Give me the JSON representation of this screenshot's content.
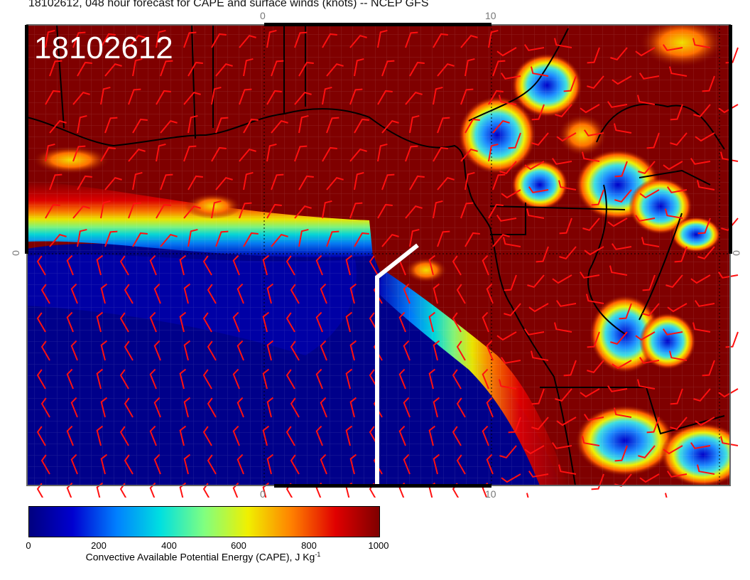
{
  "header": {
    "title": "18102612, 048 hour forecast for CAPE and surface winds (knots) -- NCEP GFS",
    "stamp": "18102612"
  },
  "axes": {
    "top_labels": [
      "0",
      "10"
    ],
    "bottom_labels": [
      "0",
      "10"
    ],
    "left_label": "0",
    "right_label": "0"
  },
  "colorbar": {
    "ticks": [
      "0",
      "200",
      "400",
      "600",
      "800",
      "1000"
    ],
    "label_main": "Convective Available Potential Energy (CAPE), J Kg",
    "label_sup": "-1",
    "colors": [
      "#00007f",
      "#0000d0",
      "#0080ff",
      "#00e0e0",
      "#80ff80",
      "#f0f000",
      "#ff8000",
      "#e00000",
      "#7f0000"
    ]
  },
  "map": {
    "land_color": "#7f0000",
    "ocean_color": "#000091",
    "wind_barb_color": "#ff1010",
    "track_color": "#ffffff"
  }
}
